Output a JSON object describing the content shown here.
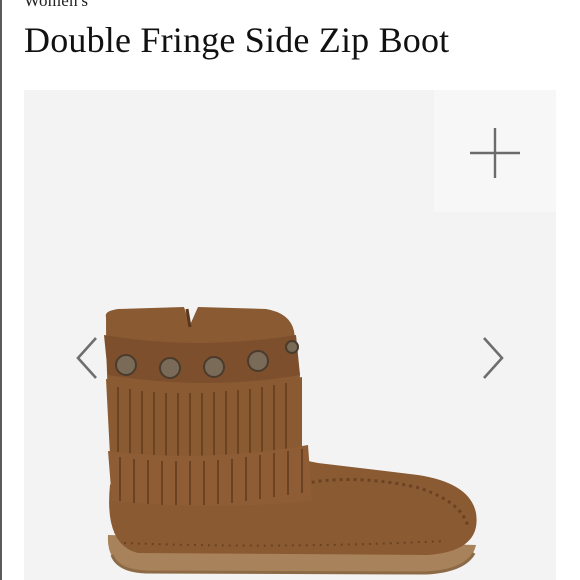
{
  "product": {
    "category": "Women's",
    "title": "Double Fringe Side Zip Boot"
  },
  "gallery": {
    "zoom_icon": "plus-icon",
    "prev_icon": "chevron-left-icon",
    "next_icon": "chevron-right-icon"
  },
  "colors": {
    "suede": "#8a5a33",
    "suede_dark": "#6b4222",
    "sole": "#a8825a",
    "background": "#f3f3f3"
  }
}
